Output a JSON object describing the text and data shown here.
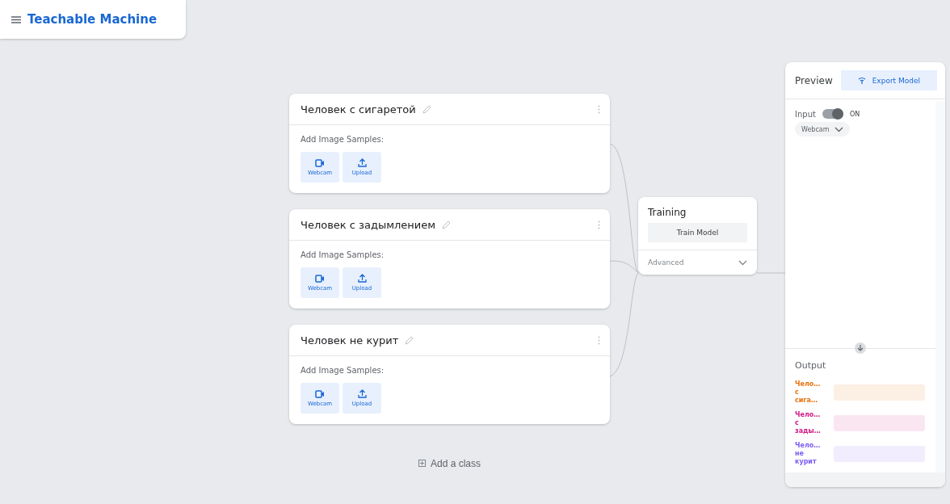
{
  "header": {
    "title": "Teachable Machine"
  },
  "classes": [
    {
      "name": "Человек с сигаретой",
      "samples_label": "Add Image Samples:",
      "buttons": [
        {
          "kind": "webcam",
          "label": "Webcam"
        },
        {
          "kind": "upload",
          "label": "Upload"
        }
      ]
    },
    {
      "name": "Человек с задымлением",
      "samples_label": "Add Image Samples:",
      "buttons": [
        {
          "kind": "webcam",
          "label": "Webcam"
        },
        {
          "kind": "upload",
          "label": "Upload"
        }
      ]
    },
    {
      "name": "Человек не курит",
      "samples_label": "Add Image Samples:",
      "buttons": [
        {
          "kind": "webcam",
          "label": "Webcam"
        },
        {
          "kind": "upload",
          "label": "Upload"
        }
      ]
    }
  ],
  "add_class": "Add a class",
  "training": {
    "title": "Training",
    "button": "Train Model",
    "advanced": "Advanced",
    "expanded": false
  },
  "preview": {
    "title": "Preview",
    "export": "Export Model",
    "input_label": "Input",
    "input_on": true,
    "input_state": "ON",
    "source": "Webcam",
    "output_title": "Output",
    "outputs": [
      {
        "label": "Чело… с сига…",
        "color": "#e8710a"
      },
      {
        "label": "Чело… с зады…",
        "color": "#d01884"
      },
      {
        "label": "Чело… не курит",
        "color": "#7b5cf5"
      }
    ]
  }
}
